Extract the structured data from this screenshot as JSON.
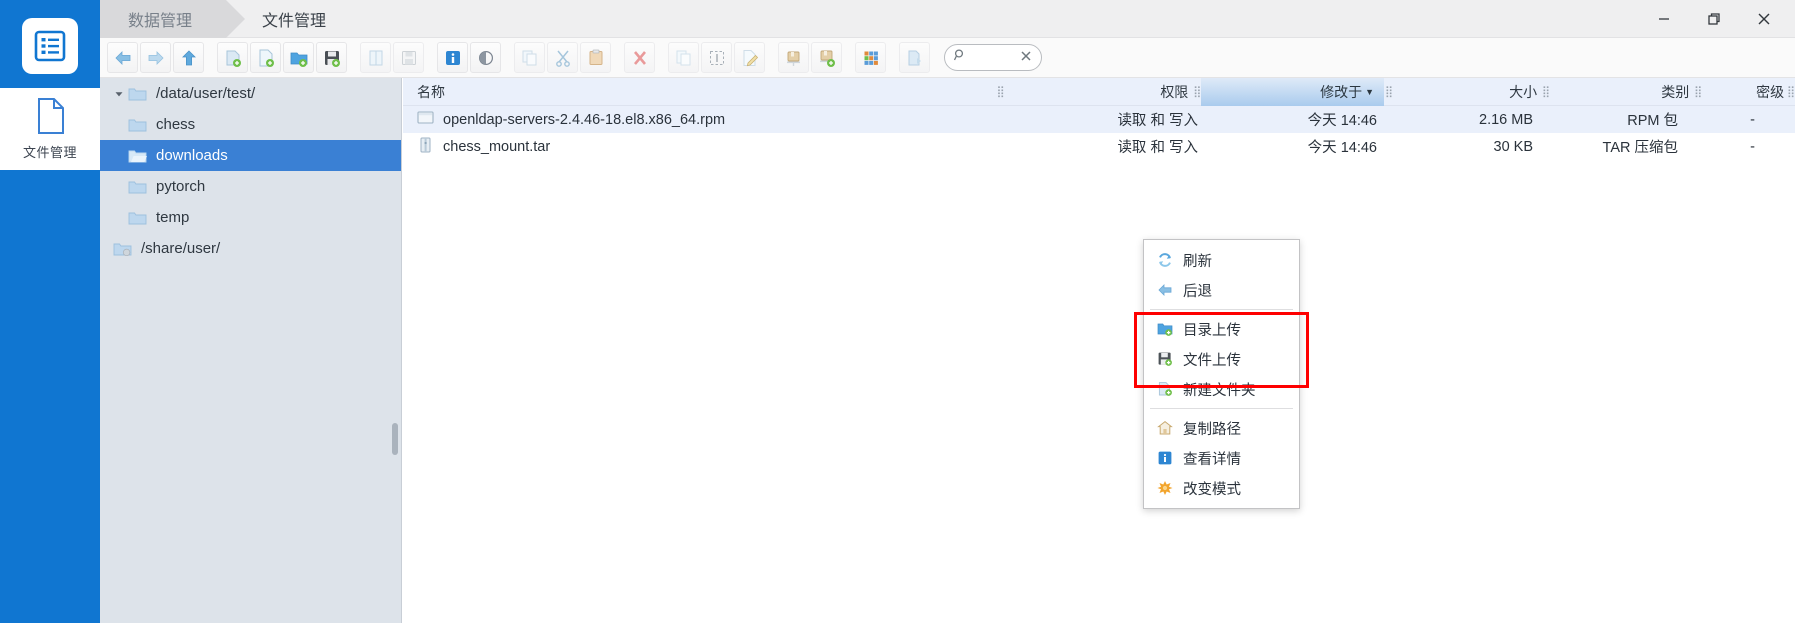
{
  "rail": {
    "logo_icon": "list-app-logo-icon",
    "item": {
      "label": "文件管理",
      "icon": "file-page-icon"
    }
  },
  "titlebar": {
    "breadcrumbs": [
      {
        "label": "数据管理",
        "active": false
      },
      {
        "label": "文件管理",
        "active": true
      }
    ],
    "window_controls": [
      {
        "name": "minimize",
        "glyph": "—"
      },
      {
        "name": "maximize",
        "glyph": "❐"
      },
      {
        "name": "close",
        "glyph": "✕"
      }
    ]
  },
  "toolbar": {
    "buttons": [
      {
        "name": "back-icon",
        "group": 1
      },
      {
        "name": "forward-icon",
        "group": 1
      },
      {
        "name": "up-icon",
        "group": 1
      },
      {
        "name": "new-window-icon",
        "group": 2
      },
      {
        "name": "new-file-icon",
        "group": 2
      },
      {
        "name": "new-folder-icon",
        "group": 2
      },
      {
        "name": "save-icon",
        "group": 2
      },
      {
        "name": "open-book-icon",
        "group": 3
      },
      {
        "name": "save-as-icon",
        "group": 3
      },
      {
        "name": "info-icon",
        "group": 4
      },
      {
        "name": "preview-eye-icon",
        "group": 4
      },
      {
        "name": "copy-icon",
        "group": 5
      },
      {
        "name": "cut-icon",
        "group": 5
      },
      {
        "name": "paste-icon",
        "group": 5
      },
      {
        "name": "delete-icon",
        "group": 6
      },
      {
        "name": "duplicate-icon",
        "group": 7
      },
      {
        "name": "select-all-icon",
        "group": 7
      },
      {
        "name": "rename-icon",
        "group": 7
      },
      {
        "name": "archive-icon",
        "group": 8
      },
      {
        "name": "archive-add-icon",
        "group": 8
      },
      {
        "name": "grid-view-icon",
        "group": 9
      },
      {
        "name": "transfer-icon",
        "group": 10
      }
    ],
    "search": {
      "placeholder": "",
      "value": "",
      "icon": "search-icon",
      "clear_icon": "clear-icon"
    }
  },
  "tree": {
    "nodes": [
      {
        "label": "/data/user/test/",
        "level": 1,
        "expanded": true,
        "selected": false,
        "icon": "folder-icon"
      },
      {
        "label": "chess",
        "level": 2,
        "selected": false,
        "icon": "folder-icon"
      },
      {
        "label": "downloads",
        "level": 2,
        "selected": true,
        "icon": "folder-open-icon"
      },
      {
        "label": "pytorch",
        "level": 2,
        "selected": false,
        "icon": "folder-icon"
      },
      {
        "label": "temp",
        "level": 2,
        "selected": false,
        "icon": "folder-icon"
      },
      {
        "label": "/share/user/",
        "level": 1,
        "expanded": false,
        "selected": false,
        "icon": "folder-shared-icon"
      }
    ]
  },
  "filelist": {
    "columns": [
      {
        "key": "name",
        "label": "名称"
      },
      {
        "key": "perm",
        "label": "权限"
      },
      {
        "key": "mtime",
        "label": "修改于",
        "sorted": true,
        "sort_dir": "desc"
      },
      {
        "key": "size",
        "label": "大小"
      },
      {
        "key": "type",
        "label": "类别"
      },
      {
        "key": "sec",
        "label": "密级"
      }
    ],
    "rows": [
      {
        "icon": "rpm-package-icon",
        "name": "openldap-servers-2.4.46-18.el8.x86_64.rpm",
        "perm": "读取 和 写入",
        "mtime": "今天 14:46",
        "size": "2.16 MB",
        "type": "RPM 包",
        "sec": "-"
      },
      {
        "icon": "tar-archive-icon",
        "name": "chess_mount.tar",
        "perm": "读取 和 写入",
        "mtime": "今天 14:46",
        "size": "30 KB",
        "type": "TAR 压缩包",
        "sec": "-"
      }
    ]
  },
  "context_menu": {
    "items": [
      {
        "label": "刷新",
        "icon": "refresh-icon",
        "highlighted": false
      },
      {
        "label": "后退",
        "icon": "back-arrow-icon",
        "highlighted": false
      },
      {
        "separator": true
      },
      {
        "label": "目录上传",
        "icon": "folder-upload-icon",
        "highlighted": true
      },
      {
        "label": "文件上传",
        "icon": "file-upload-icon",
        "highlighted": true
      },
      {
        "label": "新建文件夹",
        "icon": "new-folder-icon",
        "highlighted": true
      },
      {
        "separator": true
      },
      {
        "label": "复制路径",
        "icon": "home-path-icon",
        "highlighted": false
      },
      {
        "label": "查看详情",
        "icon": "info-icon",
        "highlighted": false
      },
      {
        "label": "改变模式",
        "icon": "gear-star-icon",
        "highlighted": false
      }
    ],
    "highlight_color": "#fe0000"
  },
  "colors": {
    "rail_blue": "#1076d1",
    "tree_bg": "#dde3ea",
    "selection_blue": "#3a80d4",
    "row_alt": "#eaf0fb",
    "annotation_red": "#fe0000"
  }
}
